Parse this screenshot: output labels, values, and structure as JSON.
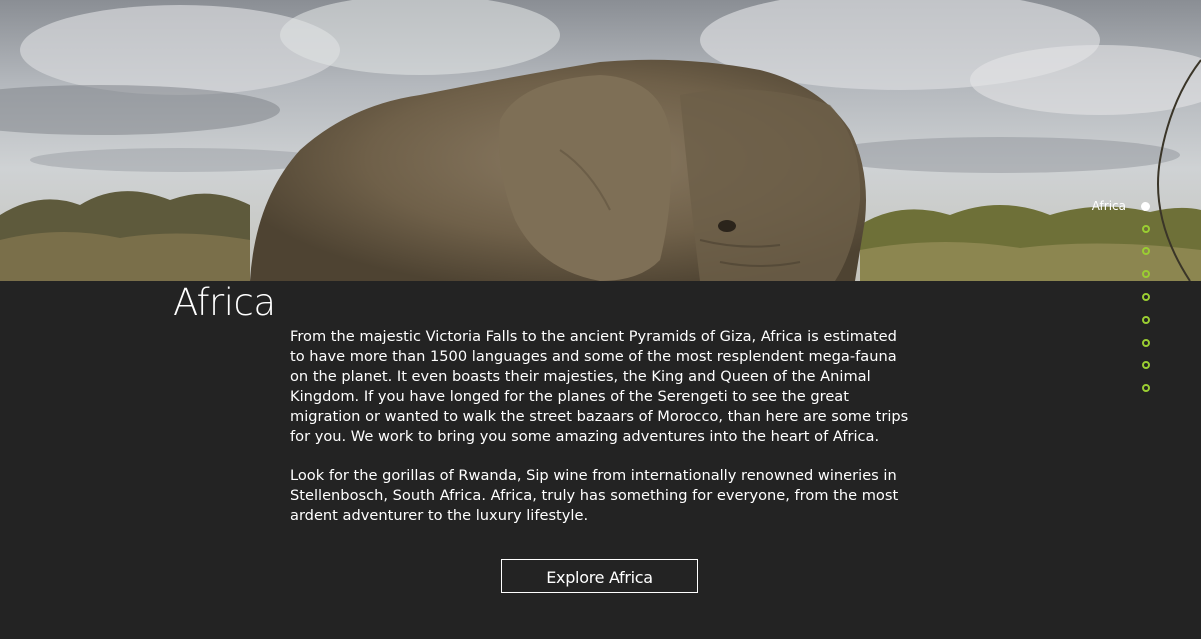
{
  "hero": {
    "image": "elephant-savanna-photo"
  },
  "section": {
    "title": "Africa",
    "paragraphs": [
      "From the majestic Victoria Falls to the ancient Pyramids of Giza, Africa is estimated to have more than 1500 languages and some of the most resplendent mega-fauna on the planet. It even boasts their majesties, the King and Queen of the Animal Kingdom. If you have longed for the planes of the Serengeti to see the great migration or wanted to walk the street bazaars of Morocco, than here are some trips for you. We work to bring you some amazing adventures into the heart of Africa.",
      "Look for the gorillas of Rwanda, Sip wine from internationally renowned wineries in Stellenbosch, South Africa. Africa, truly has something for everyone, from the most ardent adventurer to the luxury lifestyle."
    ],
    "button_label": "Explore Africa"
  },
  "anchor_nav": {
    "active_label": "Africa",
    "dot_count": 9,
    "active_index": 0
  },
  "colors": {
    "background": "#232323",
    "text": "#ffffff",
    "accent": "#9acd32"
  }
}
